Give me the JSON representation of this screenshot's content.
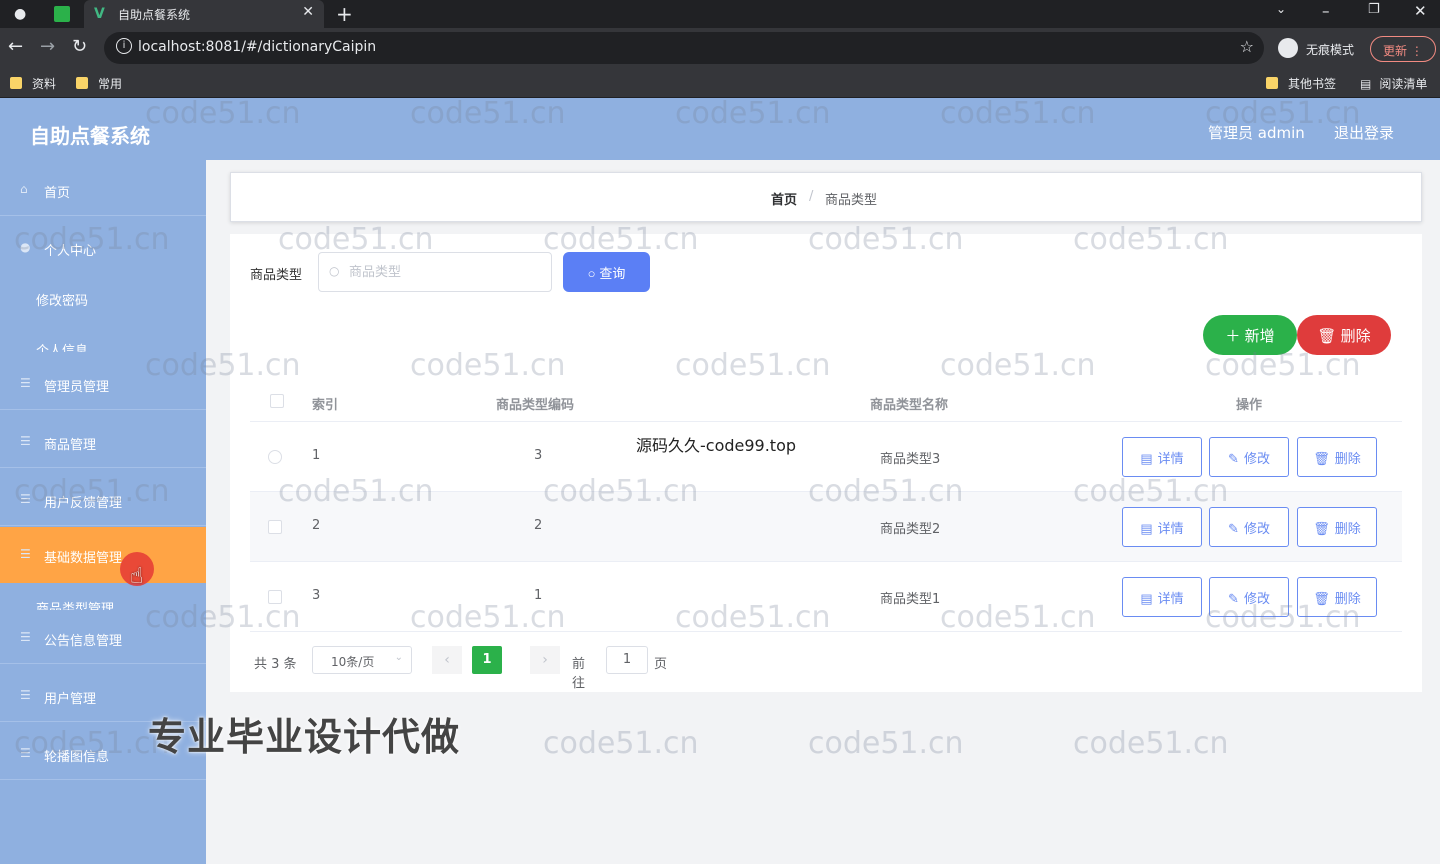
{
  "browser": {
    "tab_title": "自助点餐系统",
    "tab_close": "✕",
    "new_tab": "+",
    "url": "localhost:8081/#/dictionaryCaipin",
    "incognito_label": "无痕模式",
    "update_label": "更新",
    "bookmarks": [
      "资料",
      "常用"
    ],
    "bookmarks_right": [
      "其他书签",
      "阅读清单"
    ]
  },
  "header": {
    "title": "自助点餐系统",
    "user": "管理员 admin",
    "logout": "退出登录"
  },
  "sidebar": {
    "items": [
      {
        "label": "首页",
        "icon": "home-icon"
      },
      {
        "label": "个人中心",
        "icon": "user-icon"
      },
      {
        "label": "修改密码",
        "icon": ""
      },
      {
        "label": "个人信息",
        "icon": ""
      },
      {
        "label": "管理员管理",
        "icon": "menu-icon"
      },
      {
        "label": "商品管理",
        "icon": "menu-icon"
      },
      {
        "label": "用户反馈管理",
        "icon": "menu-icon"
      },
      {
        "label": "基础数据管理",
        "icon": "menu-icon"
      },
      {
        "label": "商品类型管理",
        "icon": ""
      },
      {
        "label": "公告信息管理",
        "icon": "menu-icon"
      },
      {
        "label": "用户管理",
        "icon": "menu-icon"
      },
      {
        "label": "轮播图信息",
        "icon": "menu-icon"
      }
    ],
    "active_color": "#ffa445"
  },
  "breadcrumb": {
    "home": "首页",
    "separator": "/",
    "current": "商品类型"
  },
  "search": {
    "label": "商品类型",
    "placeholder": "商品类型",
    "button": "查询"
  },
  "actions": {
    "add": "新增",
    "delete": "删除"
  },
  "table": {
    "headers": {
      "index": "索引",
      "code": "商品类型编码",
      "name": "商品类型名称",
      "ops": "操作"
    },
    "rows": [
      {
        "index": "1",
        "code": "3",
        "name": "商品类型3"
      },
      {
        "index": "2",
        "code": "2",
        "name": "商品类型2"
      },
      {
        "index": "3",
        "code": "1",
        "name": "商品类型1"
      }
    ],
    "op_labels": {
      "detail": "详情",
      "edit": "修改",
      "delete": "删除"
    }
  },
  "pagination": {
    "total": "共 3 条",
    "page_size": "10条/页",
    "current_page": "1",
    "goto_label": "前往",
    "goto_value": "1",
    "page_unit": "页"
  },
  "overlays": {
    "watermark": "code51.cn",
    "code99": "源码久久-code99.top",
    "ad": "专业毕业设计代做"
  },
  "colors": {
    "header_bg": "#8fb0e0",
    "primary": "#5b7ff5",
    "success": "#2bb14a",
    "danger": "#df3c3c"
  }
}
